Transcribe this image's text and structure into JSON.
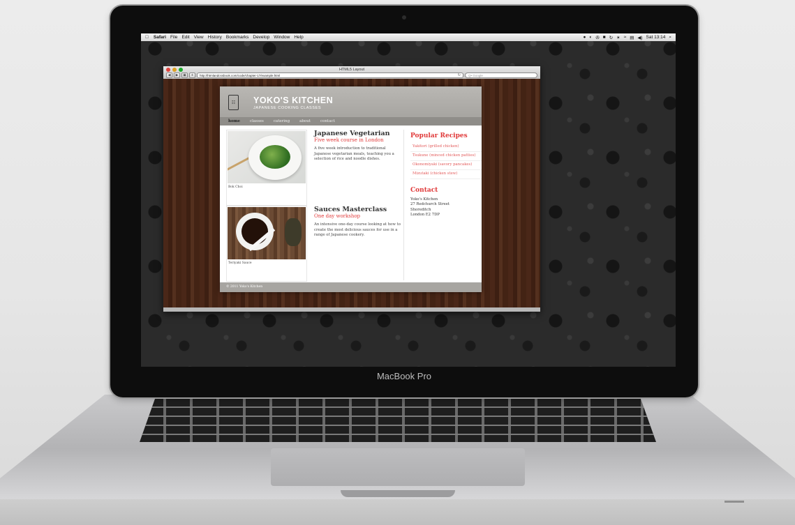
{
  "laptop": {
    "brand": "MacBook Pro"
  },
  "menubar": {
    "apple": "",
    "items": [
      "Safari",
      "File",
      "Edit",
      "View",
      "History",
      "Bookmarks",
      "Develop",
      "Window",
      "Help"
    ],
    "clock": "Sat 13:14",
    "status_icons": [
      "●",
      "◐",
      "✇",
      "■",
      "↻",
      "✶",
      "≈",
      "▤",
      "◀)",
      "⌕"
    ]
  },
  "browser": {
    "window_title": "HTML5 Layout",
    "url": "http://htmlandcssbook.com/code/chapter-17/example.html",
    "search_placeholder": "Q• Google",
    "nav_back": "◀",
    "nav_forward": "▶",
    "share": "▣",
    "add": "+"
  },
  "site": {
    "logo_text": "☷",
    "title": "YOKO'S KITCHEN",
    "tagline": "JAPANESE COOKING CLASSES",
    "nav": [
      "home",
      "classes",
      "catering",
      "about",
      "contact"
    ],
    "articles": [
      {
        "caption": "Bok Choi",
        "title": "Japanese Vegetarian",
        "subtitle": "Five week course in London",
        "body": "A five week introduction to traditional Japanese vegetarian meals, teaching you a selection of rice and noodle dishes."
      },
      {
        "caption": "Teriyaki Sauce",
        "title": "Sauces Masterclass",
        "subtitle": "One day workshop",
        "body": "An intensive one-day course looking at how to create the most delicious sauces for use in a range of Japanese cookery."
      }
    ],
    "sidebar": {
      "recipes_heading": "Popular Recipes",
      "recipes": [
        "Yakitori (grilled chicken)",
        "Tsukune (minced chicken patties)",
        "Okonomiyaki (savory pancakes)",
        "Mizutaki (chicken stew)"
      ],
      "contact_heading": "Contact",
      "address": [
        "Yoko's Kitchen",
        "27 Redchurch Street",
        "Shoreditch",
        "London E2 7DP"
      ]
    },
    "footer": "© 2011 Yoko's Kitchen"
  }
}
